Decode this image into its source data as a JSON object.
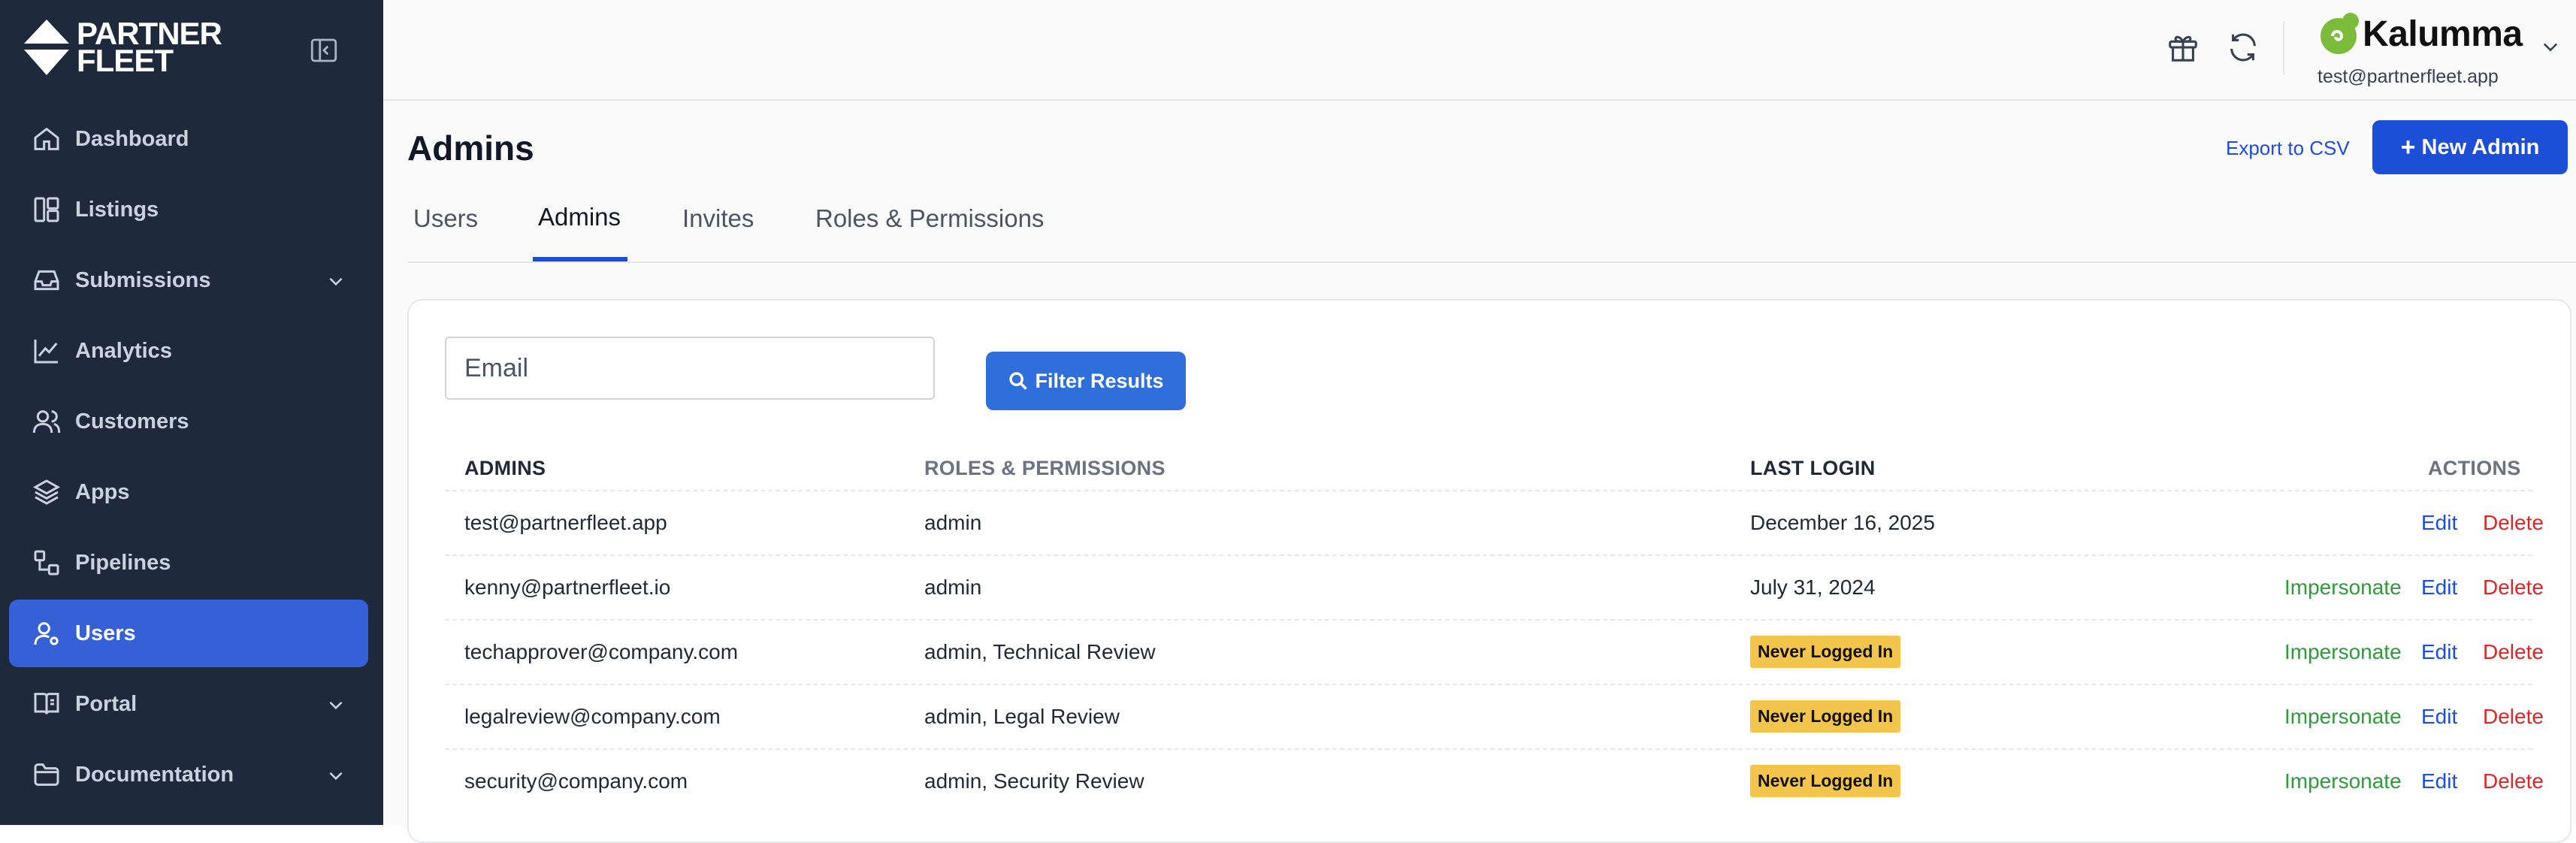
{
  "brand": {
    "line1": "PARTNER",
    "line2": "FLEET"
  },
  "sidebar": {
    "items": [
      {
        "label": "Dashboard",
        "icon": "home-icon",
        "active": false,
        "expandable": false
      },
      {
        "label": "Listings",
        "icon": "layout-icon",
        "active": false,
        "expandable": false
      },
      {
        "label": "Submissions",
        "icon": "inbox-icon",
        "active": false,
        "expandable": true
      },
      {
        "label": "Analytics",
        "icon": "chart-line-icon",
        "active": false,
        "expandable": false
      },
      {
        "label": "Customers",
        "icon": "users-icon",
        "active": false,
        "expandable": false
      },
      {
        "label": "Apps",
        "icon": "layers-icon",
        "active": false,
        "expandable": false
      },
      {
        "label": "Pipelines",
        "icon": "pipeline-icon",
        "active": false,
        "expandable": false
      },
      {
        "label": "Users",
        "icon": "user-cog-icon",
        "active": true,
        "expandable": false
      },
      {
        "label": "Portal",
        "icon": "book-icon",
        "active": false,
        "expandable": true
      },
      {
        "label": "Documentation",
        "icon": "folder-icon",
        "active": false,
        "expandable": true
      }
    ]
  },
  "header": {
    "account_name": "Kalumma",
    "account_email": "test@partnerfleet.app"
  },
  "page": {
    "title": "Admins",
    "export_label": "Export to CSV",
    "new_button_label": "New Admin",
    "tabs": [
      {
        "label": "Users",
        "active": false
      },
      {
        "label": "Admins",
        "active": true
      },
      {
        "label": "Invites",
        "active": false
      },
      {
        "label": "Roles & Permissions",
        "active": false
      }
    ]
  },
  "filter": {
    "email_placeholder": "Email",
    "email_value": "",
    "button_label": "Filter Results"
  },
  "table": {
    "columns": [
      "ADMINS",
      "ROLES & PERMISSIONS",
      "LAST LOGIN",
      "ACTIONS"
    ],
    "rows": [
      {
        "email": "test@partnerfleet.app",
        "roles": "admin",
        "last_login": "December 16, 2025",
        "never": false,
        "actions": [
          "Edit",
          "Delete"
        ]
      },
      {
        "email": "kenny@partnerfleet.io",
        "roles": "admin",
        "last_login": "July 31, 2024",
        "never": false,
        "actions": [
          "Impersonate",
          "Edit",
          "Delete"
        ]
      },
      {
        "email": "techapprover@company.com",
        "roles": "admin, Technical Review",
        "last_login": "Never Logged In",
        "never": true,
        "actions": [
          "Impersonate",
          "Edit",
          "Delete"
        ]
      },
      {
        "email": "legalreview@company.com",
        "roles": "admin, Legal Review",
        "last_login": "Never Logged In",
        "never": true,
        "actions": [
          "Impersonate",
          "Edit",
          "Delete"
        ]
      },
      {
        "email": "security@company.com",
        "roles": "admin, Security Review",
        "last_login": "Never Logged In",
        "never": true,
        "actions": [
          "Impersonate",
          "Edit",
          "Delete"
        ]
      }
    ]
  },
  "colors": {
    "sidebar_bg": "#1e2a3b",
    "active_nav": "#3560d6",
    "primary": "#1d4ed8",
    "badge": "#f3c54a",
    "impersonate": "#2f9a3a",
    "delete": "#dc2626"
  }
}
